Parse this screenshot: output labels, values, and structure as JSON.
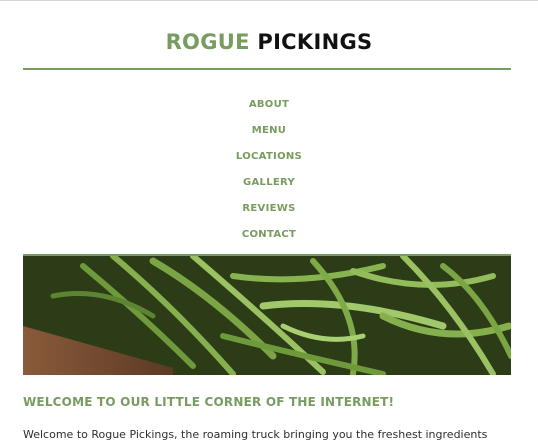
{
  "site": {
    "title_part1": "ROGUE",
    "title_part2": "PICKINGS",
    "accent_color": "#789b5f"
  },
  "nav": {
    "items": [
      {
        "label": "ABOUT"
      },
      {
        "label": "MENU"
      },
      {
        "label": "LOCATIONS"
      },
      {
        "label": "GALLERY"
      },
      {
        "label": "REVIEWS"
      },
      {
        "label": "CONTACT"
      }
    ]
  },
  "hero": {
    "image_subject": "green beans on a wooden table"
  },
  "main": {
    "heading": "WELCOME TO OUR LITTLE CORNER OF THE INTERNET!",
    "intro": "Welcome to Rogue Pickings, the roaming truck bringing you the freshest ingredients"
  }
}
